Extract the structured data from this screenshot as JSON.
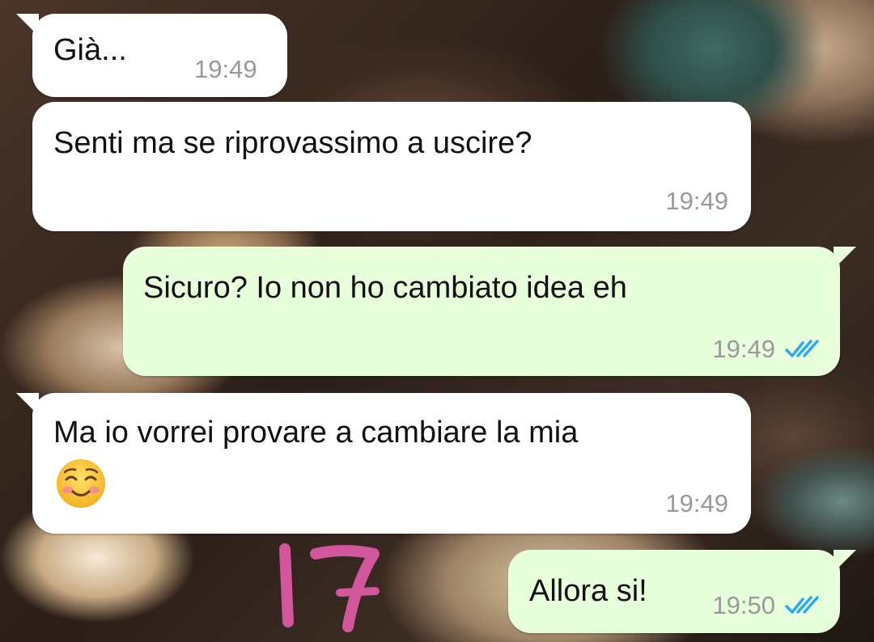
{
  "messages": [
    {
      "direction": "incoming",
      "text": "Già...",
      "time": "19:49"
    },
    {
      "direction": "incoming",
      "text": "Senti ma se riprovassimo a uscire?",
      "time": "19:49"
    },
    {
      "direction": "outgoing",
      "text": "Sicuro? Io non ho cambiato idea eh",
      "time": "19:49",
      "status": "read",
      "status_icon": "double-check-icon"
    },
    {
      "direction": "incoming",
      "text": "Ma io vorrei provare a cambiare la mia",
      "emoji": "☺️",
      "emoji_name": "smiling-face-icon",
      "time": "19:49"
    },
    {
      "direction": "outgoing",
      "text": "Allora si!",
      "time": "19:50",
      "status": "read",
      "status_icon": "double-check-icon"
    }
  ],
  "annotation": {
    "text": "17",
    "color": "#d2569c"
  },
  "colors": {
    "incoming_bubble": "#ffffff",
    "outgoing_bubble": "#e7ffdb",
    "timestamp": "#9a9a9a",
    "read_ticks": "#2ea7f5"
  }
}
